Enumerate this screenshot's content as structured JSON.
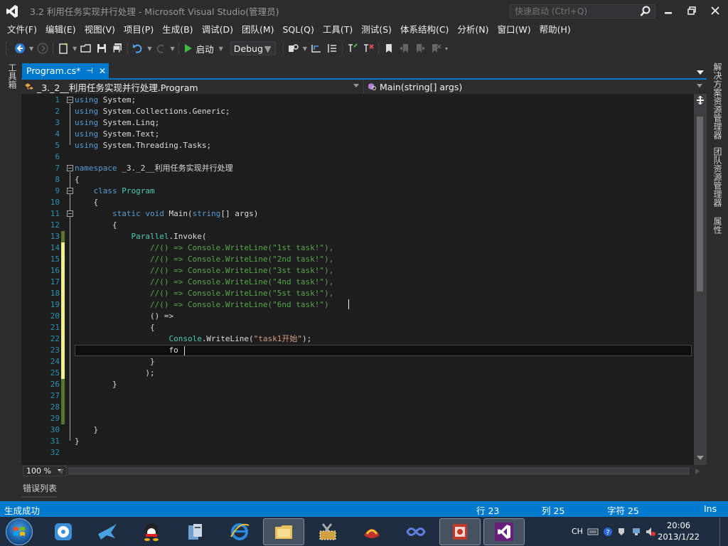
{
  "window": {
    "title": "3.2  利用任务实现并行处理 - Microsoft Visual Studio(管理员)",
    "quick_launch_placeholder": "快速启动 (Ctrl+Q)"
  },
  "menu": [
    "文件(F)",
    "编辑(E)",
    "视图(V)",
    "项目(P)",
    "生成(B)",
    "调试(D)",
    "团队(M)",
    "SQL(Q)",
    "工具(T)",
    "测试(S)",
    "体系结构(C)",
    "分析(N)",
    "窗口(W)",
    "帮助(H)"
  ],
  "toolbar": {
    "start_label": "启动",
    "configuration": "Debug"
  },
  "left_rail": {
    "toolbox": "工具箱"
  },
  "right_rail": [
    "解决方案资源管理器",
    "团队资源管理器",
    "属性"
  ],
  "document_tab": {
    "label": "Program.cs*",
    "pin": "⊣",
    "close": "✕"
  },
  "navbar": {
    "class_scope": "_3._2__利用任务实现并行处理.Program",
    "member_scope": "Main(string[] args)"
  },
  "code_lines": [
    "using System;",
    "using System.Collections.Generic;",
    "using System.Linq;",
    "using System.Text;",
    "using System.Threading.Tasks;",
    "",
    "namespace _3._2__利用任务实现并行处理",
    "{",
    "    class Program",
    "    {",
    "        static void Main(string[] args)",
    "        {",
    "            Parallel.Invoke(",
    "                //() => Console.WriteLine(\"1st task!\"),",
    "                //() => Console.WriteLine(\"2nd task!\"),",
    "                //() => Console.WriteLine(\"3st task!\"),",
    "                //() => Console.WriteLine(\"4nd task!\"),",
    "                //() => Console.WriteLine(\"5st task!\"),",
    "                //() => Console.WriteLine(\"6nd task!\")",
    "                () =>",
    "                {",
    "                    Console.WriteLine(\"task1开始\");",
    "                    fo",
    "                }",
    "               );",
    "        }",
    "",
    "",
    "",
    "    }",
    "}",
    ""
  ],
  "editor": {
    "zoom": "100 %"
  },
  "error_list": {
    "label": "错误列表"
  },
  "status": {
    "message": "生成成功",
    "line": "行 23",
    "col": "列 25",
    "char": "字符 25",
    "mode": "Ins"
  },
  "taskbar": {
    "lang": "CH",
    "time": "20:06",
    "date": "2013/1/22"
  },
  "colors": {
    "accent": "#007acc",
    "keyword": "#569cd6",
    "type": "#4ec9b0",
    "comment": "#57a64a",
    "string": "#d69d85",
    "line_number": "#2b91af"
  }
}
